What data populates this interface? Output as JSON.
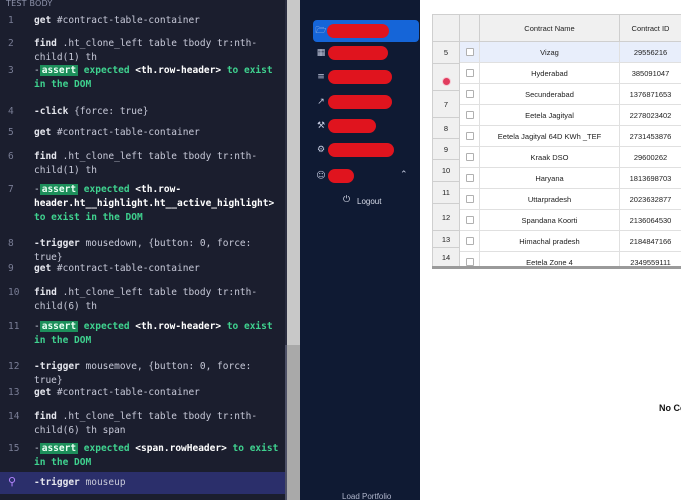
{
  "command_log": {
    "header": "TEST BODY",
    "commands": [
      {
        "n": "1",
        "kind": "get",
        "arg": "#contract-table-container"
      },
      {
        "n": "2",
        "kind": "find",
        "arg": ".ht_clone_left table tbody tr:nth-child(1) th"
      },
      {
        "n": "3",
        "kind": "assert",
        "badge": "assert",
        "pre": "expected",
        "elem": "<th.row-header>",
        "post": "to exist in the DOM"
      },
      {
        "n": "4",
        "kind": "click",
        "prefix": "-click",
        "arg": "{force: true}"
      },
      {
        "n": "5",
        "kind": "get",
        "arg": "#contract-table-container"
      },
      {
        "n": "6",
        "kind": "find",
        "arg": ".ht_clone_left table tbody tr:nth-child(1) th"
      },
      {
        "n": "7",
        "kind": "assert",
        "badge": "assert",
        "pre": "expected",
        "elem": "<th.row-header.ht__highlight.ht__active_highlight>",
        "post": "to exist in the DOM"
      },
      {
        "n": "8",
        "kind": "trigger",
        "prefix": "-trigger",
        "arg": "mousedown, {button: 0, force: true}"
      },
      {
        "n": "9",
        "kind": "get",
        "arg": "#contract-table-container"
      },
      {
        "n": "10",
        "kind": "find",
        "arg": ".ht_clone_left table tbody tr:nth-child(6) th"
      },
      {
        "n": "11",
        "kind": "assert",
        "badge": "assert",
        "pre": "expected",
        "elem": "<th.row-header>",
        "post": "to exist in the DOM"
      },
      {
        "n": "12",
        "kind": "trigger",
        "prefix": "-trigger",
        "arg": "mousemove, {button: 0, force: true}"
      },
      {
        "n": "13",
        "kind": "get",
        "arg": "#contract-table-container"
      },
      {
        "n": "14",
        "kind": "find",
        "arg": ".ht_clone_left table tbody tr:nth-child(6) th span"
      },
      {
        "n": "15",
        "kind": "assert",
        "badge": "assert",
        "pre": "expected",
        "elem": "<span.rowHeader>",
        "post": "to exist in the DOM"
      },
      {
        "n": "",
        "kind": "trigger",
        "prefix": "-trigger",
        "arg": "mouseup"
      }
    ]
  },
  "sidebar": {
    "items": [
      {
        "icon": "folder-icon",
        "glyph": "🗁",
        "redacted_label": "Contracts"
      },
      {
        "icon": "calendar-icon",
        "glyph": "▦",
        "redacted_label": "Calendar"
      },
      {
        "icon": "list-icon",
        "glyph": "≡",
        "redacted_label": "Reports"
      },
      {
        "icon": "chart-icon",
        "glyph": "↗",
        "redacted_label": "Analytics"
      },
      {
        "icon": "wrench-icon",
        "glyph": "⚒",
        "redacted_label": "Tools"
      },
      {
        "icon": "gear-icon",
        "glyph": "⚙",
        "redacted_label": "Settings"
      },
      {
        "icon": "user-icon",
        "glyph": "☺",
        "redacted_label": "User"
      }
    ],
    "logout_label": "Logout",
    "load_portfolio_label": "Load Portfolio"
  },
  "table": {
    "columns": [
      "",
      "Contract Name",
      "Contract ID"
    ],
    "rows": [
      {
        "header": "",
        "name": "Vizag",
        "id": "29556216"
      },
      {
        "header": "",
        "name": "Hyderabad",
        "id": "385091047"
      },
      {
        "header": "7",
        "name": "Secunderabad",
        "id": "1376871653"
      },
      {
        "header": "8",
        "name": "Eetela Jagityal",
        "id": "2278023402"
      },
      {
        "header": "9",
        "name": "Eetela Jagityal 64D KWh _TEF",
        "id": "2731453876"
      },
      {
        "header": "10",
        "name": "Kraak DSO",
        "id": "29600262"
      },
      {
        "header": "11",
        "name": "Haryana",
        "id": "1813698703"
      },
      {
        "header": "12",
        "name": "Uttarpradesh",
        "id": "2023632877"
      },
      {
        "header": "13",
        "name": "Spandana Koorti",
        "id": "2136064530"
      },
      {
        "header": "14",
        "name": "Himachal pradesh",
        "id": "2184847166"
      },
      {
        "header": "",
        "name": "Eetela Zone 4",
        "id": "2349559111"
      }
    ],
    "row_header_5": "5"
  },
  "no_contract_text": "No Co",
  "colors": {
    "log_bg": "#1b1e2e",
    "sidebar_bg": "#0f1a33",
    "active_nav": "#1565d8",
    "redaction": "#e0141e",
    "assert_badge": "#1d8f5b"
  }
}
